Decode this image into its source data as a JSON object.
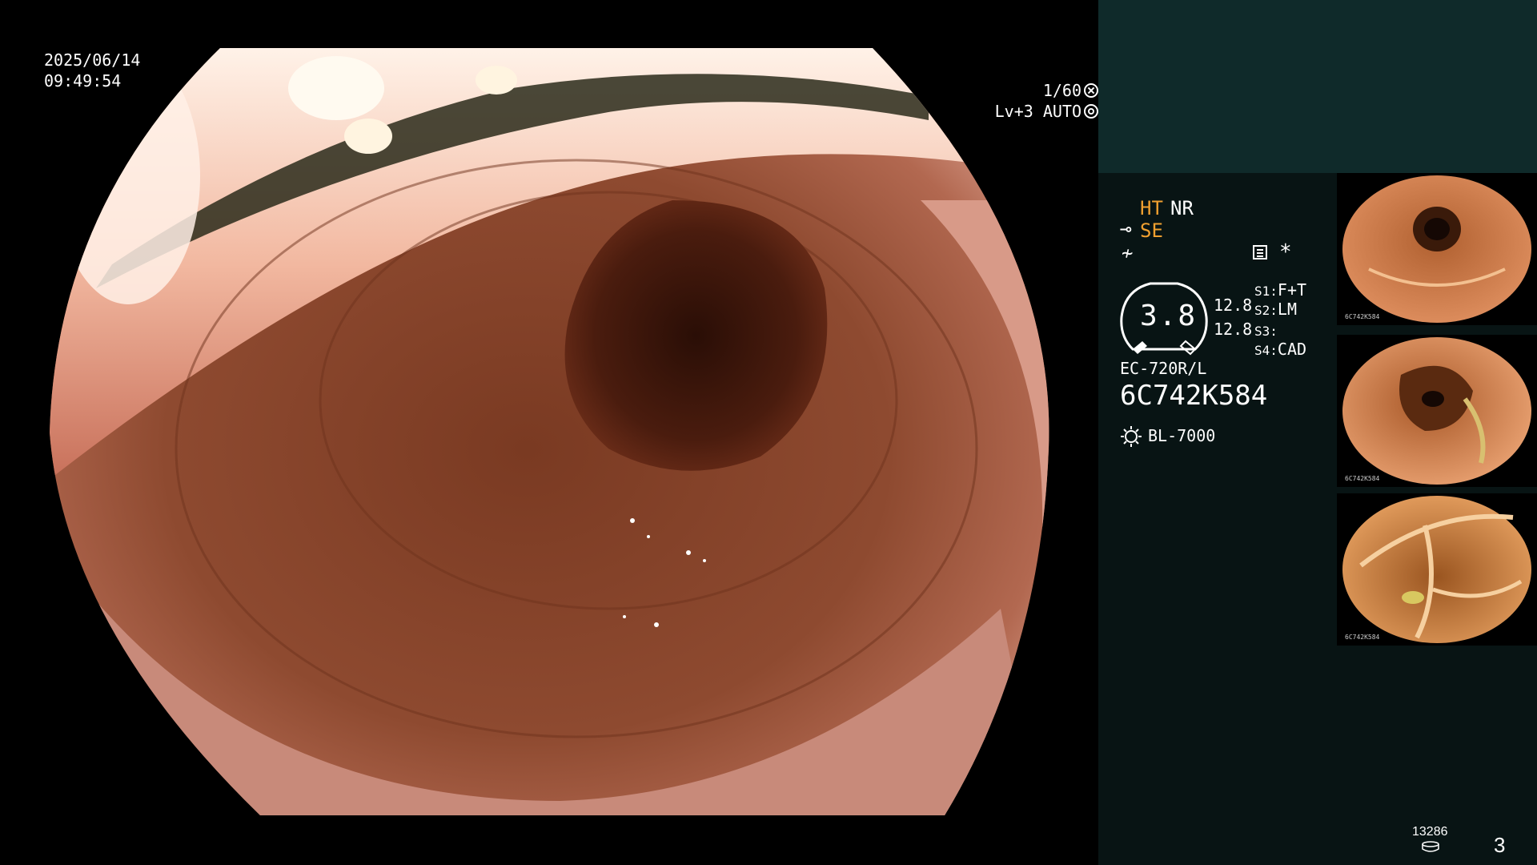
{
  "osd": {
    "date": "2025/06/14",
    "time": "09:49:54",
    "shutter": "1/60",
    "exposure": "Lv+3 AUTO"
  },
  "panel": {
    "ht": "HT",
    "nr": "NR",
    "se": "SE",
    "zoom_value": "3.8",
    "gauge_a": "12.8",
    "gauge_b": "12.8",
    "switches": [
      {
        "key": "S1:",
        "value": "F+T"
      },
      {
        "key": "S2:",
        "value": "LM"
      },
      {
        "key": "S3:",
        "value": ""
      },
      {
        "key": "S4:",
        "value": "CAD"
      }
    ],
    "scope_model": "EC-720R/L",
    "scope_serial": "6C742K584",
    "light_source": "BL-7000"
  },
  "thumbnails": [
    {
      "label": "6C742K584"
    },
    {
      "label": "6C742K584"
    },
    {
      "label": "6C742K584"
    }
  ],
  "footer": {
    "counter": "13286",
    "page": "3"
  },
  "icons": {
    "shutter": "shutter-icon",
    "iris": "iris-icon",
    "scope": "scope-icon",
    "filter": "filter-icon",
    "mode": "mode-icon",
    "star": "asterisk-icon",
    "light": "light-bulb-icon",
    "disk": "disk-icon"
  },
  "colors": {
    "accent": "#f0a030",
    "panel_bg": "#081414",
    "panel_top": "#0f2a2a"
  }
}
